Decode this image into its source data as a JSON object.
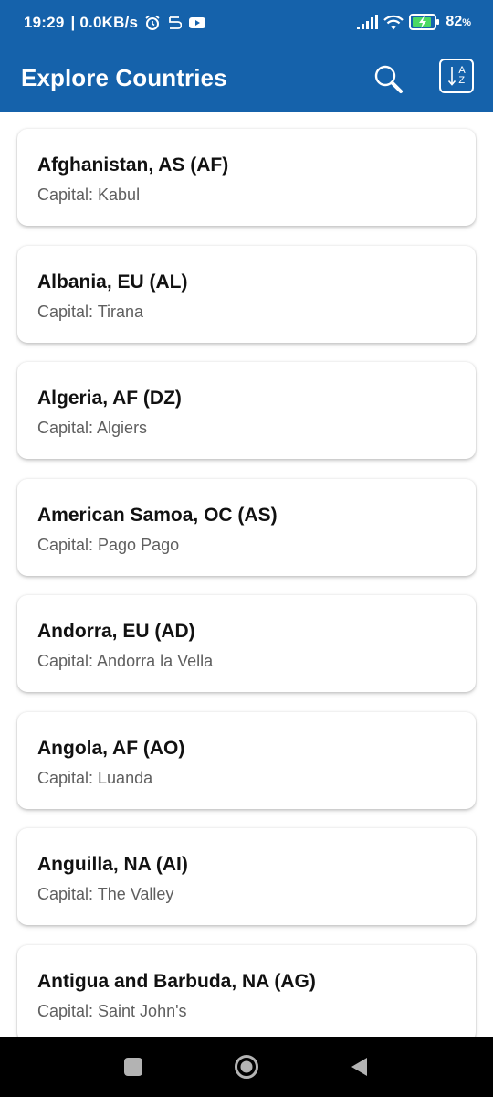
{
  "status_bar": {
    "time": "19:29",
    "network_speed": "| 0.0KB/s",
    "battery_percent": "82",
    "battery_unit": "%",
    "icons": [
      "alarm-icon",
      "data-saver-icon",
      "youtube-icon",
      "signal-icon",
      "wifi-icon",
      "battery-charging-icon"
    ]
  },
  "app_bar": {
    "title": "Explore Countries",
    "search_icon": "search-icon",
    "sort_icon": "sort-az-icon",
    "sort_label_a": "A",
    "sort_label_z": "Z"
  },
  "countries": [
    {
      "name": "Afghanistan, AS (AF)",
      "capital": "Capital: Kabul"
    },
    {
      "name": "Albania, EU (AL)",
      "capital": "Capital: Tirana"
    },
    {
      "name": "Algeria, AF (DZ)",
      "capital": "Capital: Algiers"
    },
    {
      "name": "American Samoa, OC (AS)",
      "capital": "Capital: Pago Pago"
    },
    {
      "name": "Andorra, EU (AD)",
      "capital": "Capital: Andorra la Vella"
    },
    {
      "name": "Angola, AF (AO)",
      "capital": "Capital: Luanda"
    },
    {
      "name": "Anguilla, NA (AI)",
      "capital": "Capital: The Valley"
    },
    {
      "name": "Antigua and Barbuda, NA (AG)",
      "capital": "Capital: Saint John's"
    }
  ],
  "nav_bar": {
    "icons": [
      "recents-square-icon",
      "home-circle-icon",
      "back-triangle-icon"
    ]
  },
  "colors": {
    "primary": "#1562ab",
    "card_title": "#111111",
    "card_subtitle": "#5f5f5f",
    "nav_bar": "#000000"
  }
}
